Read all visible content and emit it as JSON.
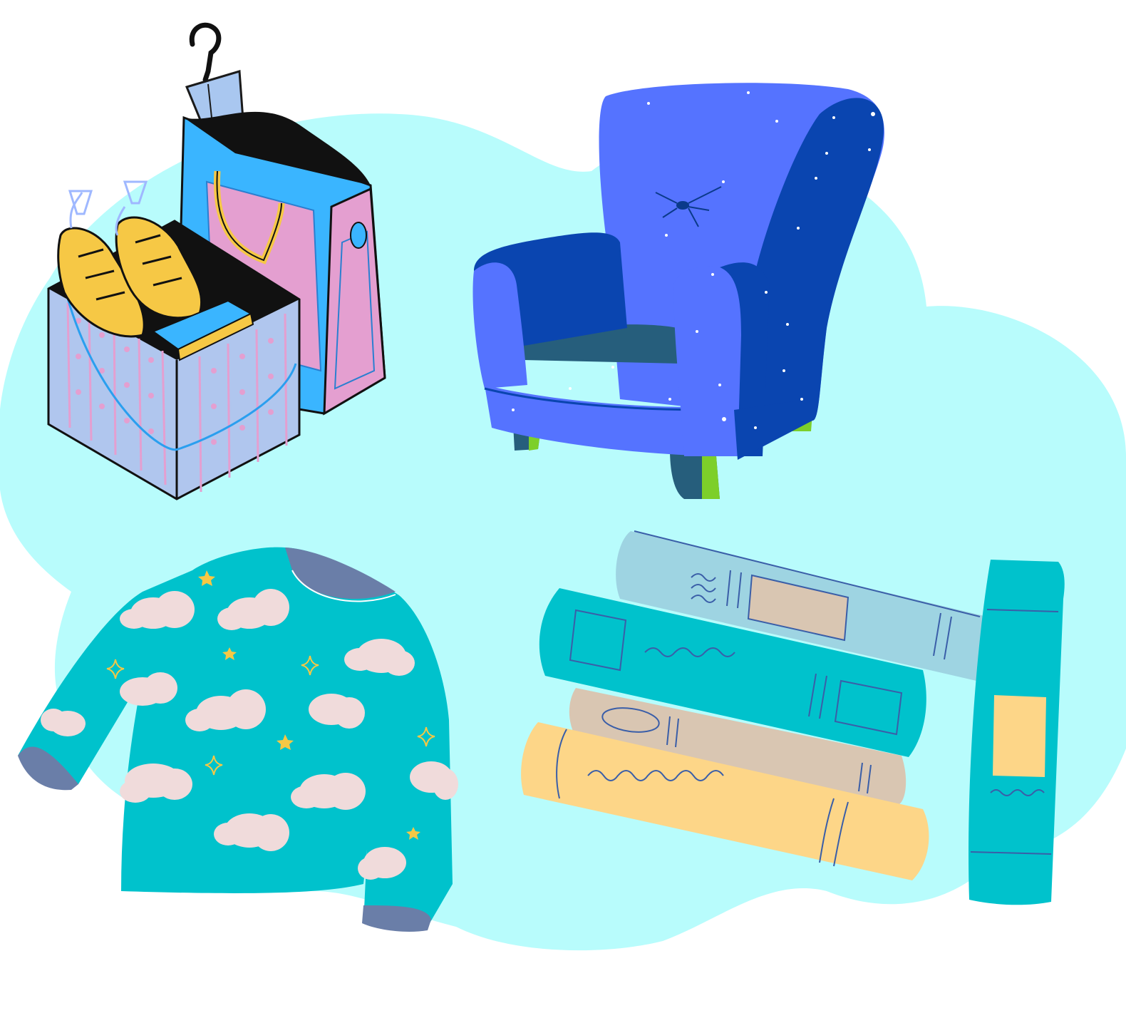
{
  "illustration": {
    "items": [
      "shopping-bags",
      "armchair",
      "pajama-shirt",
      "book-stack"
    ],
    "colors": {
      "background": "#ffffff",
      "cloud": "#b8fcfc",
      "armchair": "#5573ff",
      "armchair_shadow": "#0a45b0",
      "teal": "#00c2cc",
      "book_light_blue": "#9ed4e2",
      "book_tan": "#d9c6b2",
      "book_yellow": "#fdd688",
      "bag_blue": "#3ab5ff",
      "bag_pink": "#e49fd0",
      "box_lavender": "#b0c6ee",
      "bread_yellow": "#f6c845",
      "cuff_slate": "#6a7ea8",
      "outline": "#000000"
    }
  }
}
